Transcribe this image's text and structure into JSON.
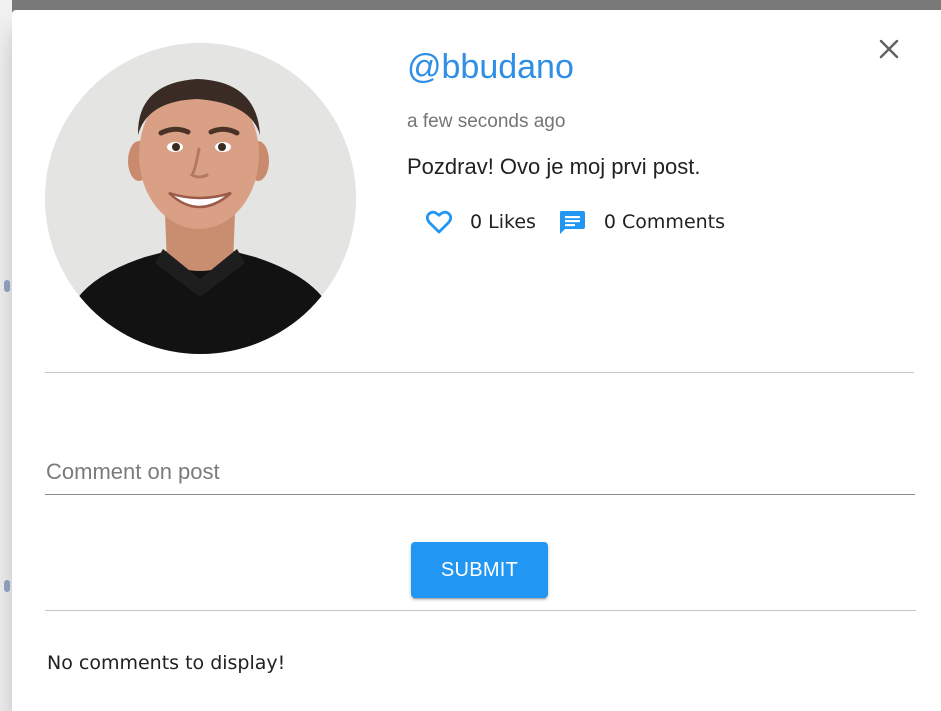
{
  "post": {
    "username": "@bbudano",
    "time": "a few seconds ago",
    "text": "Pozdrav! Ovo je moj prvi post.",
    "likes_label": "0 Likes",
    "comments_label": "0 Comments"
  },
  "comment_form": {
    "placeholder": "Comment on post",
    "value": "",
    "submit_label": "SUBMIT"
  },
  "comments": {
    "empty_message": "No comments to display!"
  },
  "icons": {
    "close": "close-icon",
    "like": "heart-outline-icon",
    "comments": "comment-icon",
    "avatar": "user-avatar-photo"
  },
  "colors": {
    "accent": "#2196f3",
    "username": "#2f8ee6",
    "overlay": "#7a7a7a"
  }
}
